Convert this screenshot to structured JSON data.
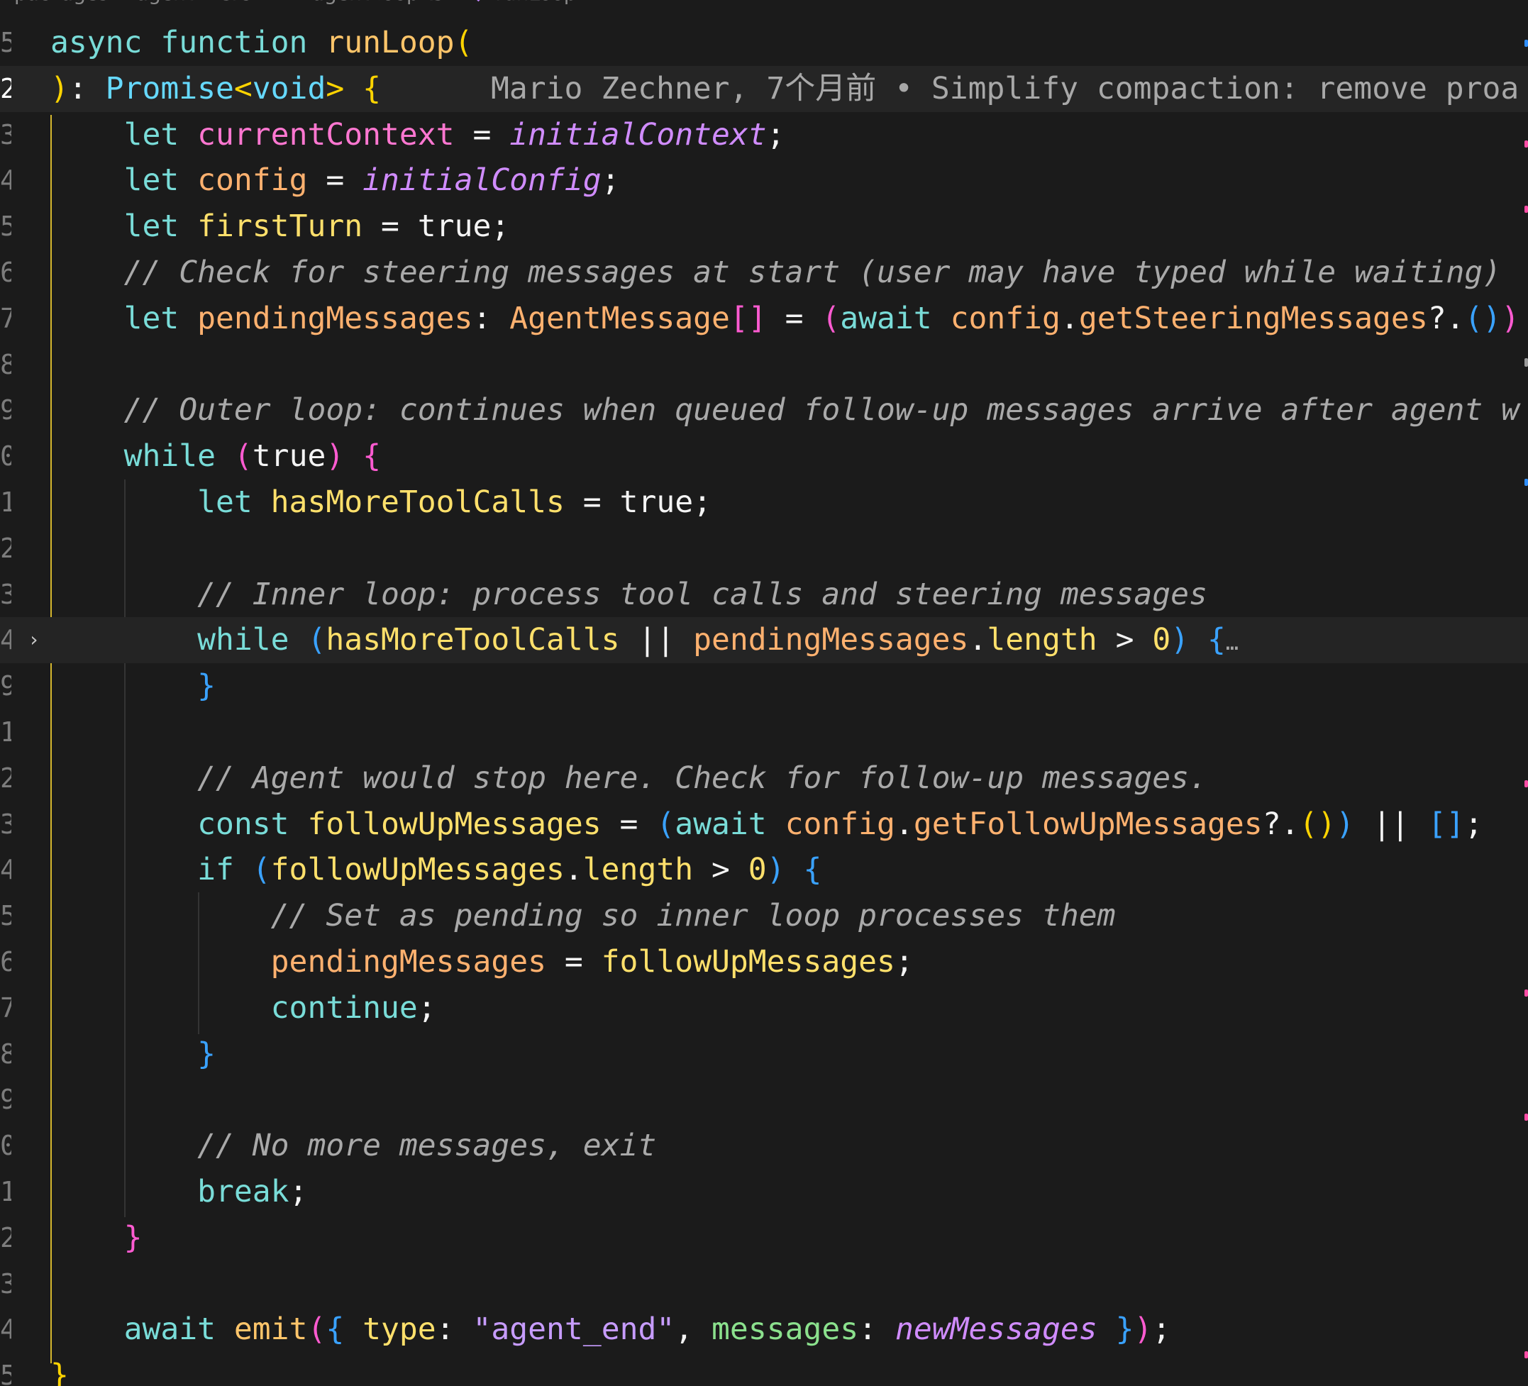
{
  "breadcrumb": {
    "items": [
      "packages",
      "agent",
      "src",
      "agent-loop.ts",
      "runLoop"
    ]
  },
  "gutter": {
    "line_numbers": [
      "5",
      "2",
      "3",
      "4",
      "5",
      "6",
      "7",
      "8",
      "9",
      "0",
      "1",
      "2",
      "3",
      "4",
      "9",
      "1",
      "2",
      "3",
      "4",
      "5",
      "6",
      "7",
      "8",
      "9",
      "0",
      "1",
      "2",
      "3",
      "4",
      "5"
    ]
  },
  "code": {
    "l1": {
      "async": "async",
      "function": "function",
      "name": "runLoop",
      "paren": "("
    },
    "l2": {
      "close": ")",
      "colon": ": ",
      "type": "Promise",
      "generic_open": "<",
      "void": "void",
      "generic_close": ">",
      "space": " ",
      "brace": "{"
    },
    "blame": "Mario Zechner, 7个月前 • Simplify compaction: remove proa",
    "l3": {
      "indent": "    ",
      "let": "let",
      "space": " ",
      "name": "currentContext",
      "eq": " = ",
      "value": "initialContext",
      "semi": ";"
    },
    "l4": {
      "indent": "    ",
      "let": "let",
      "space": " ",
      "name": "config",
      "eq": " = ",
      "value": "initialConfig",
      "semi": ";"
    },
    "l5": {
      "indent": "    ",
      "let": "let",
      "space": " ",
      "name": "firstTurn",
      "eq": " = ",
      "value": "true",
      "semi": ";"
    },
    "l6": {
      "indent": "    ",
      "comment": "// Check for steering messages at start (user may have typed while waiting)"
    },
    "l7": {
      "indent": "    ",
      "let": "let",
      "space": " ",
      "name": "pendingMessages",
      "colon": ": ",
      "type": "AgentMessage",
      "array": "[]",
      "eq": " = ",
      "open": "(",
      "await": "await",
      "space2": " ",
      "obj": "config",
      "dot": ".",
      "method": "getSteeringMessages",
      "optional": "?.",
      "call": "()",
      "close": ")"
    },
    "l9": {
      "indent": "    ",
      "comment": "// Outer loop: continues when queued follow-up messages arrive after agent w"
    },
    "l10": {
      "indent": "    ",
      "while": "while",
      "space": " ",
      "open": "(",
      "value": "true",
      "close": ")",
      "space2": " ",
      "brace": "{"
    },
    "l11": {
      "indent": "        ",
      "let": "let",
      "space": " ",
      "name": "hasMoreToolCalls",
      "eq": " = ",
      "value": "true",
      "semi": ";"
    },
    "l13": {
      "indent": "        ",
      "comment": "// Inner loop: process tool calls and steering messages"
    },
    "l14": {
      "indent": "        ",
      "while": "while",
      "space": " ",
      "open": "(",
      "name1": "hasMoreToolCalls",
      "or": " || ",
      "name2": "pendingMessages",
      "dot": ".",
      "prop": "length",
      "gt": " > ",
      "num": "0",
      "close": ")",
      "space2": " ",
      "brace": "{",
      "ellipsis": "…"
    },
    "l15": {
      "indent": "        ",
      "brace": "}"
    },
    "l17": {
      "indent": "        ",
      "comment": "// Agent would stop here. Check for follow-up messages."
    },
    "l18": {
      "indent": "        ",
      "const": "const",
      "space": " ",
      "name": "followUpMessages",
      "eq": " = ",
      "open": "(",
      "await": "await",
      "space2": " ",
      "obj": "config",
      "dot": ".",
      "method": "getFollowUpMessages",
      "optional": "?.",
      "call": "()",
      "close": ")",
      "or": " || ",
      "empty": "[]",
      "semi": ";"
    },
    "l19": {
      "indent": "        ",
      "if": "if",
      "space": " ",
      "open": "(",
      "name": "followUpMessages",
      "dot": ".",
      "prop": "length",
      "gt": " > ",
      "num": "0",
      "close": ")",
      "space2": " ",
      "brace": "{"
    },
    "l20": {
      "indent": "            ",
      "comment": "// Set as pending so inner loop processes them"
    },
    "l21": {
      "indent": "            ",
      "name": "pendingMessages",
      "eq": " = ",
      "value": "followUpMessages",
      "semi": ";"
    },
    "l22": {
      "indent": "            ",
      "continue": "continue",
      "semi": ";"
    },
    "l23": {
      "indent": "        ",
      "brace": "}"
    },
    "l25": {
      "indent": "        ",
      "comment": "// No more messages, exit"
    },
    "l26": {
      "indent": "        ",
      "break": "break",
      "semi": ";"
    },
    "l27": {
      "indent": "    ",
      "brace": "}"
    },
    "l29": {
      "indent": "    ",
      "await": "await",
      "space": " ",
      "fn": "emit",
      "open": "(",
      "obj_open": "{ ",
      "type_key": "type",
      "colon": ": ",
      "type_value": "\"agent_end\"",
      "comma": ", ",
      "messages_key": "messages",
      "colon2": ": ",
      "messages_value": "newMessages",
      "obj_close": " }",
      "close": ")",
      "semi": ";"
    },
    "l30": {
      "brace": "}"
    }
  },
  "colors": {
    "background": "#1b1b1b",
    "gutter": "#7c7c7c",
    "current_line": "#252525",
    "blame_text": "#a8a8a8",
    "indent_guide": "#343434",
    "active_guide": "#d5b72e"
  },
  "icons": [
    "typescript-file-icon",
    "symbol-method-icon",
    "fold-chevron-right-icon"
  ]
}
